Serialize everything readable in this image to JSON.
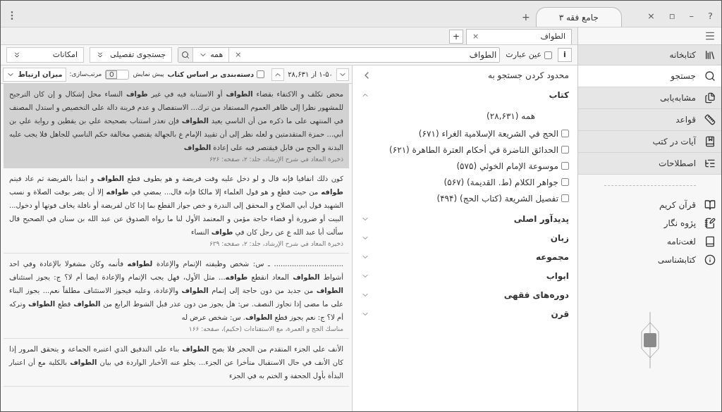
{
  "window": {
    "tab_title": "جامع فقه ۳",
    "new_tab": "+",
    "controls": [
      "?",
      "–",
      "▫",
      "×"
    ]
  },
  "doc_tabs": [
    {
      "label": "الطواف",
      "selected": true,
      "close": "×"
    }
  ],
  "doc_tab_add": "+",
  "search": {
    "info": "i",
    "exact_phrase": {
      "label": "عین عبارت",
      "checked": false
    },
    "value": "الطواف",
    "clear": "×",
    "scope": "همه",
    "advanced": "جستجوی تفصیلی",
    "options": "امکانات"
  },
  "sidebar": {
    "header": {
      "label": "کتابخانه"
    },
    "tools": [
      {
        "label": "جستجو",
        "selected": true
      },
      {
        "label": "مشابه‌یابی",
        "selected": false
      },
      {
        "label": "قواعد",
        "selected": false
      },
      {
        "label": "آیات در کتب",
        "selected": false
      },
      {
        "label": "اصطلاحات",
        "selected": false
      }
    ],
    "resources": [
      {
        "label": "قرآن کریم"
      },
      {
        "label": "پژوه نگار"
      },
      {
        "label": "لغت‌نامه"
      },
      {
        "label": "کتابشناسی"
      }
    ]
  },
  "filters": {
    "title": "محدود کردن جستجو به",
    "sections": [
      {
        "title": "کتاب",
        "expanded": true,
        "all": "همه (۲۸,۶۳۱)",
        "items": [
          {
            "label": "الحج في الشريعة الإسلامية الغراء (۶۷۱)",
            "checked": false
          },
          {
            "label": "الحدائق الناضرة في أحكام العترة الطاهرة (۶۲۱)",
            "checked": false
          },
          {
            "label": "موسوعة الإمام الخوئي (۵۷۵)",
            "checked": false
          },
          {
            "label": "جواهر الكلام (ط. القديمة) (۵۶۷)",
            "checked": false
          },
          {
            "label": "تفصيل الشريعة (كتاب الحج) (۴۹۴)",
            "checked": false
          }
        ]
      },
      {
        "title": "پدیدآور اصلی",
        "expanded": false
      },
      {
        "title": "زبان",
        "expanded": false
      },
      {
        "title": "مجموعه",
        "expanded": false
      },
      {
        "title": "ابواب",
        "expanded": false
      },
      {
        "title": "دوره‌های فقهی",
        "expanded": false
      },
      {
        "title": "قرن",
        "expanded": false
      }
    ]
  },
  "results": {
    "range": "۱-۵۰ از ۲۸,۶۳۱",
    "group_by_book": {
      "label": "دسته‌بندی بر اساس کتاب",
      "checked": false
    },
    "preview": {
      "label": "پیش نمایش",
      "on": false,
      "knob": "O"
    },
    "sort_label": "مرتب‌سازی:",
    "sort_value": "میزان ارتباط",
    "items": [
      {
        "selected": true,
        "text": "محض تكلف و الاكتفاء بقضاء **الطواف** أو الاستنابة فيه في غير **طواف** النساء محل إشكال و إن كان الترجيح للمشهور نظرا إلى ظاهر العموم المستفاد من ترك... الاستفصال و عدم قرينة دالة على التخصيص و استدل المصنف في المنتهى على ما ذكره من أن الناسي يعيد **الطواف** فإن تعذر استتاب بصحيحة علي بن يقطين و رواية علي بن أبي... حمزة المتقدمتين و لعله نظر إلى أن تقييد الإمام ع بالجهالة يقتضي مخالفة حكم الناسي للجاهل فلا يجب عليه البدنة و الحج من قابل فيقتصر فيه على إعادة **الطواف**",
        "source": "ذخيرة المعاد في شرح الإرشاد، جلد: ٢، صفحه: ۶۲۶"
      },
      {
        "selected": false,
        "text": "كون ذلك اتفاقيا فإنه قال و لو دخل عليه وقت فريضة و هو يطوف قطع **الطواف** و ابتدأ بالفريضة ثم عاد فيتم **طوافه** من حيث قطع و هو قول العلماء إلا مالكا فإنه قال... يمضي في **طوافه** إلا أن يضر بوقت الصلاة و نسب الشهيد قول أبي الصلاح و المحقق إلى الندرة و خص جواز القطع بما إذا كان لفريضة أو نافلة يخاف فوتها أو دخول... البيت أو ضرورة أو قضاء حاجة مؤمن و المعتمد الأول لنا ما رواه الصدوق عن عبد الله بن سنان في الصحيح قال سألت أبا عبد الله ع عن رجل كان في **طواف** النساء",
        "source": "ذخيرة المعاد في شرح الإرشاد، جلد: ٢، صفحه: ۶۳۹"
      },
      {
        "selected": false,
        "text": "............................... ـ س: شخص وظيفته الإتمام والإعادة **لطوافه** فأتمه وكان مشغولا بالإعادة وفي احد أشواط **الطواف** المعاد انقطع **طوافه**... مثل الأول، فهل يجب الإتمام والإعادة ايضا أم لا؟ ج: يجوز استئناف **الطواف** من جديد من دون حاجة إلى إتمام **الطواف** والإعادة، وعليه فيجوز الاستئناف مطلقاً نعم... يجوز البناء على ما مضى إذا تجاوز النصف. س: هل يجوز من دون عذر قبل الشوط الرابع من **الطواف** قطع **الطواف** وتركه أم لا؟ ج: نعم يجوز قطع **الطواف**. س: شخص عرض له",
        "source": "مناسك الحج و العمرة، مع الاستفتاءات (حكيم)، صفحه: ۱۶۶"
      },
      {
        "selected": false,
        "text": "الأنف على الجزء المتقدم من الحجر فلا يصح **الطواف** بناء على التدقيق الذي اعتبره الجماعة و يتحقق المرور إذا كان الأنف في حال الاستقبال متأخرا عن الجزء... يخلو عنه الأخبار الواردة في بيان **الطواف** بالكلية مع أن اعتبار البدأة بأول الجحفة و الختم به في الجزء"
      }
    ]
  }
}
